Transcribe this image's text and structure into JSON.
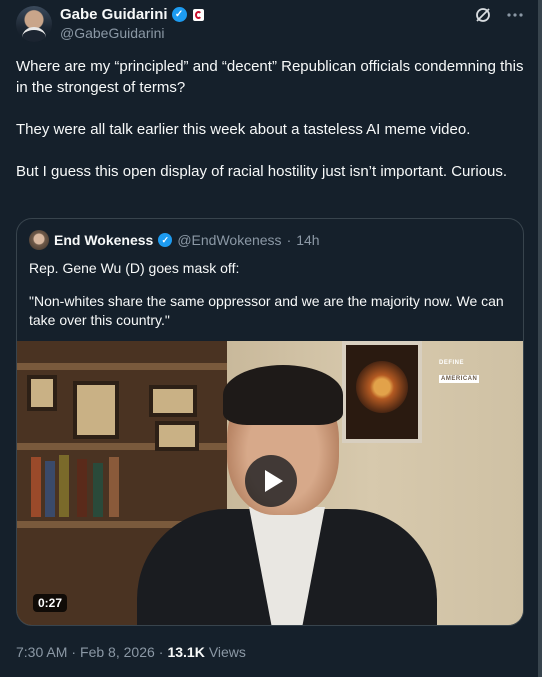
{
  "author": {
    "display_name": "Gabe Guidarini",
    "handle": "@GabeGuidarini"
  },
  "tweet": {
    "paragraphs": [
      "Where are my “principled” and “decent” Republican officials condemning this in the strongest of terms?",
      "They were all talk earlier this week about a tasteless AI meme video.",
      "But I guess this open display of racial hostility just isn’t important. Curious."
    ]
  },
  "quote": {
    "display_name": "End Wokeness",
    "handle": "@EndWokeness",
    "separator": "·",
    "time_ago": "14h",
    "text_lines": [
      "Rep. Gene Wu (D) goes mask off:",
      "\"Non-whites share the same oppressor and we are the majority now. We can take over this country.\""
    ],
    "video": {
      "duration": "0:27",
      "logo_line1": "DEFINE",
      "logo_line2": "AMERICAN"
    }
  },
  "meta": {
    "time": "7:30 AM",
    "separator1": "·",
    "date": "Feb 8, 2026",
    "separator2": "·",
    "views_count": "13.1K",
    "views_label": "Views"
  },
  "colors": {
    "background": "#15202b",
    "accent": "#1d9bf0",
    "text": "#f7f9f9",
    "muted": "#8b98a5",
    "border": "#38444d"
  },
  "icons": [
    "verified-badge-icon",
    "flag-icon",
    "grok-icon",
    "more-icon",
    "play-icon"
  ]
}
